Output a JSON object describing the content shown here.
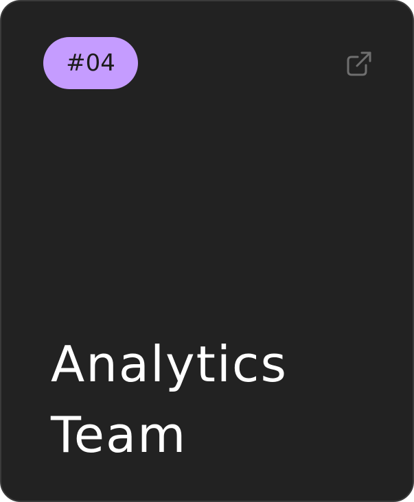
{
  "card": {
    "badge": "#04",
    "title_line1": "Analytics",
    "title_line2": "Team",
    "open_icon": "external-link-icon",
    "colors": {
      "background": "#222222",
      "badge": "#c59cff",
      "text": "#ffffff",
      "icon": "#6f6f6f"
    }
  }
}
